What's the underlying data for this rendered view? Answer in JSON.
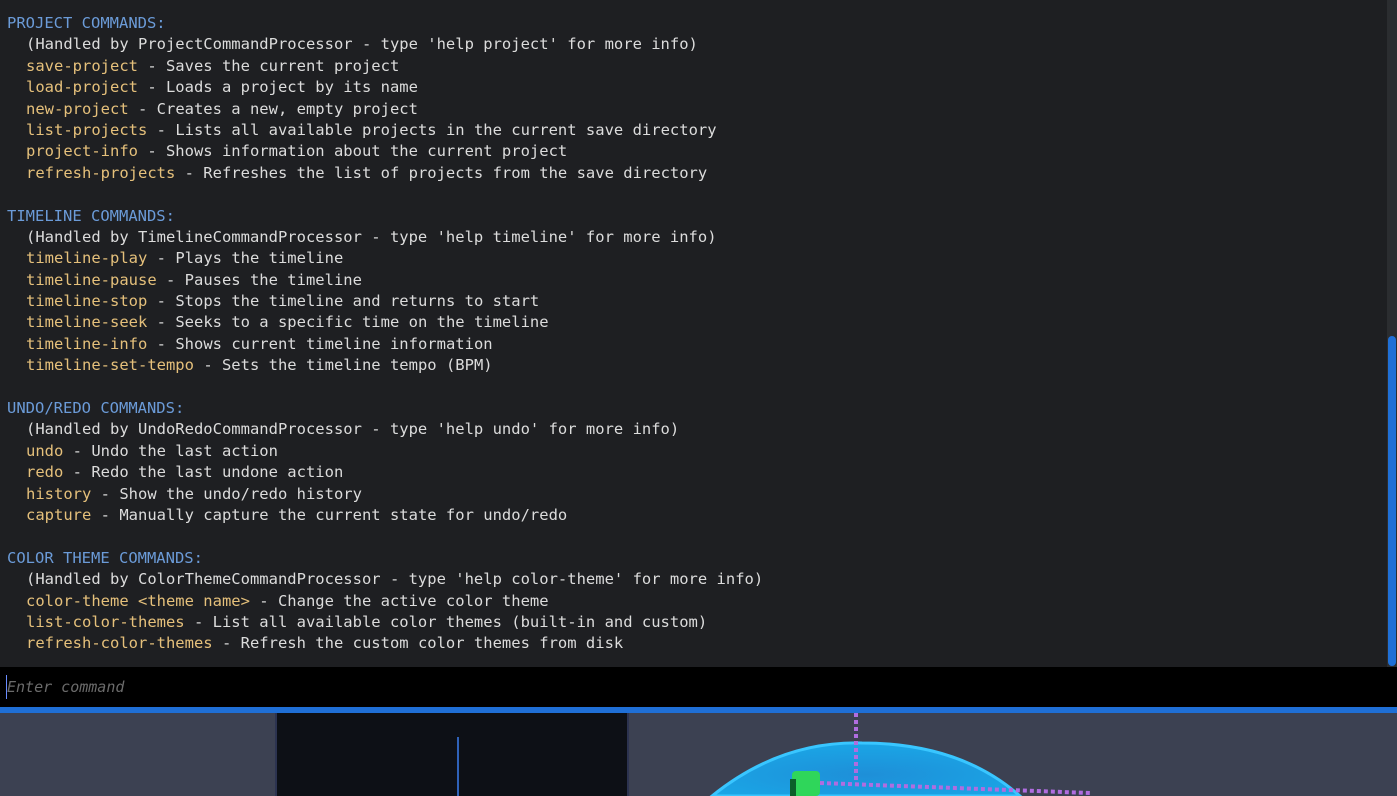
{
  "console": {
    "sections": [
      {
        "heading": "PROJECT COMMANDS:",
        "note": "(Handled by ProjectCommandProcessor - type 'help project' for more info)",
        "commands": [
          {
            "name": "save-project",
            "desc": " - Saves the current project"
          },
          {
            "name": "load-project",
            "desc": " - Loads a project by its name"
          },
          {
            "name": "new-project",
            "desc": " - Creates a new, empty project"
          },
          {
            "name": "list-projects",
            "desc": " - Lists all available projects in the current save directory"
          },
          {
            "name": "project-info",
            "desc": " - Shows information about the current project"
          },
          {
            "name": "refresh-projects",
            "desc": " - Refreshes the list of projects from the save directory"
          }
        ]
      },
      {
        "heading": "TIMELINE COMMANDS:",
        "note": "(Handled by TimelineCommandProcessor - type 'help timeline' for more info)",
        "commands": [
          {
            "name": "timeline-play",
            "desc": " - Plays the timeline"
          },
          {
            "name": "timeline-pause",
            "desc": " - Pauses the timeline"
          },
          {
            "name": "timeline-stop",
            "desc": " - Stops the timeline and returns to start"
          },
          {
            "name": "timeline-seek",
            "desc": " - Seeks to a specific time on the timeline"
          },
          {
            "name": "timeline-info",
            "desc": " - Shows current timeline information"
          },
          {
            "name": "timeline-set-tempo",
            "desc": " - Sets the timeline tempo (BPM)"
          }
        ]
      },
      {
        "heading": "UNDO/REDO COMMANDS:",
        "note": "(Handled by UndoRedoCommandProcessor - type 'help undo' for more info)",
        "commands": [
          {
            "name": "undo",
            "desc": " - Undo the last action"
          },
          {
            "name": "redo",
            "desc": " - Redo the last undone action"
          },
          {
            "name": "history",
            "desc": " - Show the undo/redo history"
          },
          {
            "name": "capture",
            "desc": " - Manually capture the current state for undo/redo"
          }
        ]
      },
      {
        "heading": "COLOR THEME COMMANDS:",
        "note": "(Handled by ColorThemeCommandProcessor - type 'help color-theme' for more info)",
        "commands": [
          {
            "name": "color-theme <theme name>",
            "desc": " - Change the active color theme"
          },
          {
            "name": "list-color-themes",
            "desc": " - List all available color themes (built-in and custom)"
          },
          {
            "name": "refresh-color-themes",
            "desc": " - Refresh the custom color themes from disk"
          }
        ]
      }
    ]
  },
  "input": {
    "placeholder": "Enter command",
    "value": ""
  },
  "colors": {
    "heading": "#6b9bd8",
    "command": "#e5c07b",
    "text": "#dcdcdc",
    "background": "#1e1f22",
    "accent": "#1f6fd6"
  },
  "icons": {
    "viewport_gizmo": "3d-axis-gizmo-icon"
  }
}
